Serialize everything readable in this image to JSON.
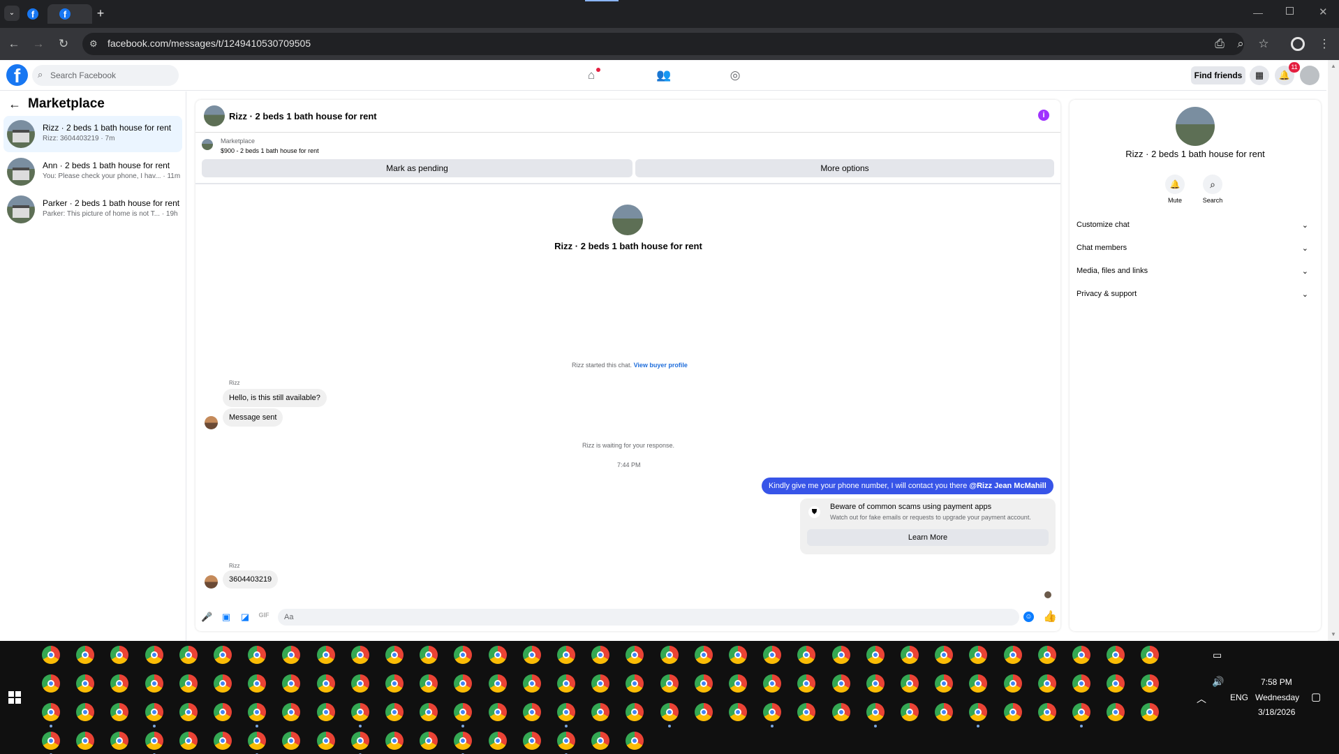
{
  "browser": {
    "url": "facebook.com/messages/t/1249410530709505",
    "tabs": [
      {
        "icon": "facebook-icon"
      },
      {
        "icon": "facebook-icon"
      }
    ],
    "new_tab": "+"
  },
  "facebook": {
    "search_placeholder": "Search Facebook",
    "find_friends": "Find friends",
    "notifications_count": "11"
  },
  "sidebar": {
    "title": "Marketplace",
    "conversations": [
      {
        "title": "Rizz · 2 beds 1 bath house for rent",
        "preview": "Rizz: 3604403219 · 7m"
      },
      {
        "title": "Ann · 2 beds 1 bath house for rent",
        "preview": "You: Please check your phone, I hav... · 11m"
      },
      {
        "title": "Parker · 2 beds 1 bath house for rent",
        "preview": "Parker: This picture of home is not T... · 19h"
      }
    ]
  },
  "chat": {
    "header_title": "Rizz · 2 beds 1 bath house for rent",
    "listing_source": "Marketplace",
    "listing_title": "$900 - 2 beds 1 bath house for rent",
    "mark_pending": "Mark as pending",
    "more_options": "More options",
    "profile_name": "Rizz · 2 beds 1 bath house for rent",
    "started_text": "Rizz started this chat.",
    "view_buyer_profile": "View buyer profile",
    "sender_name_1": "Rizz",
    "msg_1": "Hello, is this still available?",
    "msg_2": "Message sent",
    "waiting_text": "Rizz is waiting for your response.",
    "time_label": "7:44 PM",
    "outgoing_text": "Kindly give me your phone number, I will contact you there",
    "outgoing_mention": "@Rizz Jean McMahill",
    "scam_title": "Beware of common scams using payment apps",
    "scam_body": "Watch out for fake emails or requests to upgrade your payment account.",
    "learn_more": "Learn More",
    "sender_name_2": "Rizz",
    "msg_3": "3604403219",
    "composer_placeholder": "Aa"
  },
  "details": {
    "name": "Rizz · 2 beds 1 bath house for rent",
    "mute": "Mute",
    "search": "Search",
    "sections": [
      "Customize chat",
      "Chat members",
      "Media, files and links",
      "Privacy & support"
    ]
  },
  "taskbar": {
    "time": "7:58 PM",
    "day": "Wednesday",
    "date": "3/18/2026",
    "language": "ENG"
  },
  "colors": {
    "accent": "#1877f2",
    "outgoing_bubble": "#3754e8",
    "taskbar": "#101010"
  }
}
